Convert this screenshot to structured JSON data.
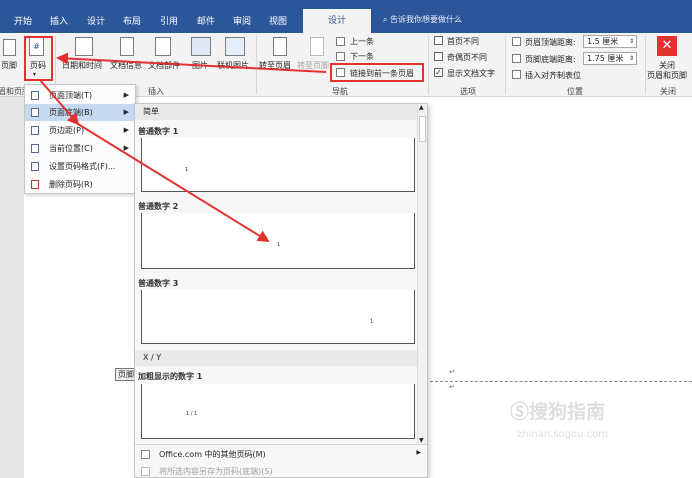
{
  "ribbon_tabs": [
    "开始",
    "插入",
    "设计",
    "布局",
    "引用",
    "邮件",
    "审阅",
    "视图"
  ],
  "active_tab": "设计",
  "tell_me": "告诉我你想要做什么",
  "ribbon": {
    "footer_btn": "页脚",
    "page_number_btn": "页码",
    "hf_group_label": "眉和页脚",
    "date_time": "日期和时间",
    "doc_info": "文档信息",
    "doc_parts": "文档部件",
    "picture": "图片",
    "online_picture": "联机图片",
    "insert_group": "插入",
    "goto_header": "转至页眉",
    "goto_footer": "转至页脚",
    "previous": "上一条",
    "next": "下一条",
    "link_previous": "链接到前一条页眉",
    "nav_group": "导航",
    "first_page_diff": "首页不同",
    "odd_even_diff": "奇偶页不同",
    "show_doc_text": "显示文档文字",
    "options_group": "选项",
    "header_top_label": "页眉顶端距离:",
    "header_top_val": "1.5 厘米",
    "footer_bottom_label": "页脚底端距离:",
    "footer_bottom_val": "1.75 厘米",
    "insert_align_tab": "插入对齐制表位",
    "position_group": "位置",
    "close_label_1": "关闭",
    "close_label_2": "页眉和页脚",
    "close_group": "关闭"
  },
  "checks": {
    "first_page": false,
    "odd_even": false,
    "show_text": true
  },
  "menu": [
    {
      "label": "页面顶端(T)",
      "arrow": true
    },
    {
      "label": "页面底端(B)",
      "arrow": true,
      "highlight": true
    },
    {
      "label": "页边距(P)",
      "arrow": true
    },
    {
      "label": "当前位置(C)",
      "arrow": true
    },
    {
      "label": "设置页码格式(F)...",
      "arrow": false
    },
    {
      "label": "删除页码(R)",
      "arrow": false
    }
  ],
  "gallery": {
    "section_simple": "简单",
    "items": [
      {
        "name": "普通数字 1",
        "num": "1"
      },
      {
        "name": "普通数字 2",
        "num": "1"
      },
      {
        "name": "普通数字 3",
        "num": "1"
      }
    ],
    "section_xy": "X / Y",
    "bold_name": "加粗显示的数字 1",
    "bold_num": "1 / 1",
    "more": "Office.com 中的其他页码(M)",
    "save": "将所选内容另存为页码(底端)(S)"
  },
  "footer_tag": "页脚",
  "watermark": "搜狗指南",
  "watermark_url": "zhinan.sogou.com",
  "para_mark": "↵",
  "colors": {
    "accent": "#2b579a",
    "annotation": "#e2322f",
    "close": "#e2322f"
  }
}
